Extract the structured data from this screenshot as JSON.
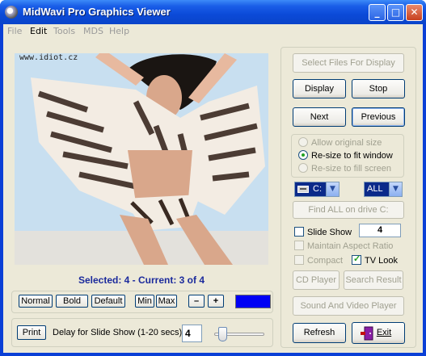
{
  "window": {
    "title": "MidWavi Pro Graphics Viewer",
    "minimize": "_",
    "maximize": "□",
    "close": "✕"
  },
  "menu": {
    "items": [
      {
        "label": "File",
        "enabled": false
      },
      {
        "label": "Edit",
        "enabled": true
      },
      {
        "label": "Tools",
        "enabled": false
      },
      {
        "label": "MDS",
        "enabled": false
      },
      {
        "label": "Help",
        "enabled": false
      }
    ]
  },
  "viewer": {
    "watermark": "www.idiot.cz",
    "status": "Selected: 4 - Current: 3 of 4"
  },
  "controls": {
    "select_files": "Select Files For Display",
    "display": "Display",
    "stop": "Stop",
    "next": "Next",
    "previous": "Previous",
    "resize_options": [
      {
        "label": "Allow original size",
        "selected": false,
        "enabled": false
      },
      {
        "label": "Re-size to fit window",
        "selected": true,
        "enabled": true
      },
      {
        "label": "Re-size to fill screen",
        "selected": false,
        "enabled": false
      }
    ],
    "drive_value": "C:",
    "filter_value": "ALL",
    "find_all": "Find ALL on drive C:",
    "slide_show_label": "Slide Show",
    "slide_show_checked": false,
    "slide_count": "4",
    "maintain_aspect": "Maintain Aspect Ratio",
    "compact": "Compact",
    "tv_look": "TV Look",
    "tv_look_checked": true,
    "cd_player": "CD Player",
    "search_result": "Search Result",
    "sound_video": "Sound And Video Player",
    "refresh": "Refresh",
    "exit": "Exit"
  },
  "font_bar": {
    "normal": "Normal",
    "bold": "Bold",
    "default": "Default",
    "min": "Min",
    "max": "Max",
    "minus": "–",
    "plus": "+",
    "swatch_color": "#0000f5"
  },
  "print_bar": {
    "print": "Print",
    "delay_label": "Delay for Slide Show (1-20 secs)",
    "delay_value": "4",
    "slider_fraction": 0.1
  }
}
